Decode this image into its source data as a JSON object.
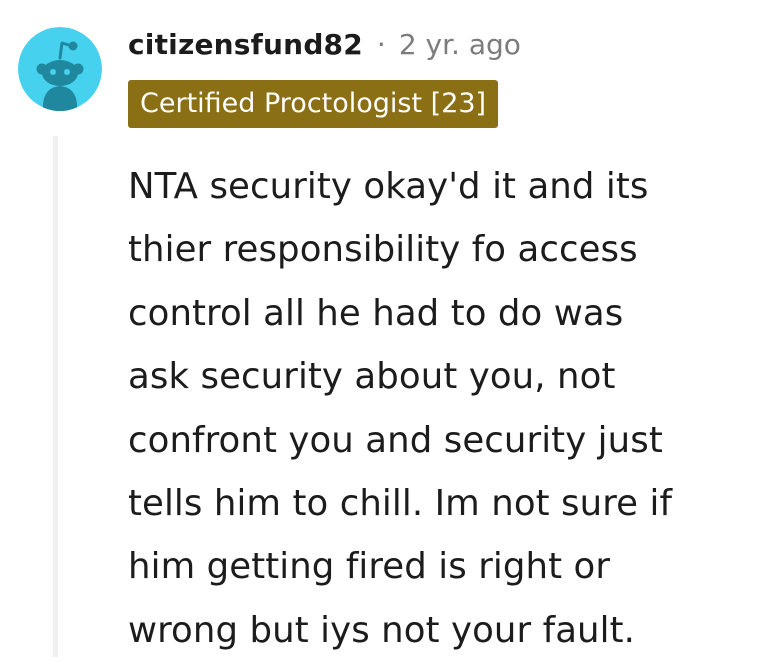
{
  "comment": {
    "username": "citizensfund82",
    "separator": "·",
    "timestamp": "2 yr. ago",
    "flair": "Certified Proctologist [23]",
    "body_lines": [
      "NTA security okay'd it and its",
      "thier responsibility fo access",
      "control all he had to do was",
      "ask security about you, not",
      "confront you and security just",
      "tells him to chill. Im not sure if",
      "him getting fired is right or",
      "wrong but iys not your fault."
    ]
  },
  "avatar": {
    "icon": "snoo-icon",
    "background_color": "#46d1ee",
    "figure_color": "#20889e"
  },
  "colors": {
    "flair_background": "#8b6f14",
    "flair_text": "#ffffff",
    "text": "#1c1c1c",
    "meta_text": "#7c7c7c",
    "thread_line": "#edeff1"
  }
}
